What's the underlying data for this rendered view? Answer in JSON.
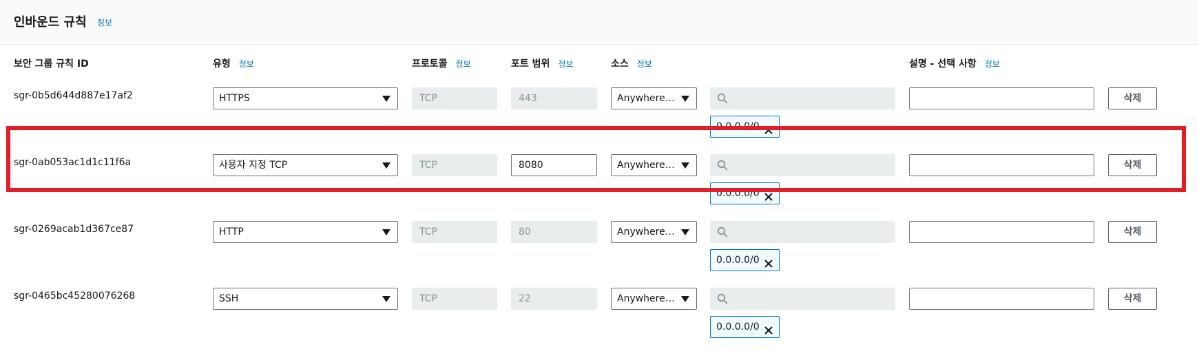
{
  "header": {
    "title": "인바운드 규칙",
    "info": "정보"
  },
  "columns": {
    "rule_id": "보안 그룹 규칙 ID",
    "type": "유형",
    "protocol": "프로토콜",
    "port_range": "포트 범위",
    "source": "소스",
    "description": "설명 - 선택 사항",
    "info": "정보"
  },
  "rows": [
    {
      "id": "sgr-0b5d644d887e17af2",
      "type": "HTTPS",
      "protocol": "TCP",
      "port": "443",
      "port_editable": false,
      "source": "Anywhere-...",
      "cidr": "0.0.0.0/0",
      "description": "",
      "delete": "삭제"
    },
    {
      "id": "sgr-0ab053ac1d1c11f6a",
      "type": "사용자 지정 TCP",
      "protocol": "TCP",
      "port": "8080",
      "port_editable": true,
      "source": "Anywhere-...",
      "cidr": "0.0.0.0/0",
      "description": "",
      "delete": "삭제",
      "highlighted": true
    },
    {
      "id": "sgr-0269acab1d367ce87",
      "type": "HTTP",
      "protocol": "TCP",
      "port": "80",
      "port_editable": false,
      "source": "Anywhere-...",
      "cidr": "0.0.0.0/0",
      "description": "",
      "delete": "삭제"
    },
    {
      "id": "sgr-0465bc45280076268",
      "type": "SSH",
      "protocol": "TCP",
      "port": "22",
      "port_editable": false,
      "source": "Anywhere-...",
      "cidr": "0.0.0.0/0",
      "description": "",
      "delete": "삭제"
    }
  ],
  "colors": {
    "link": "#0073bb",
    "highlight": "#e41e26",
    "disabled_bg": "#eaeded"
  }
}
